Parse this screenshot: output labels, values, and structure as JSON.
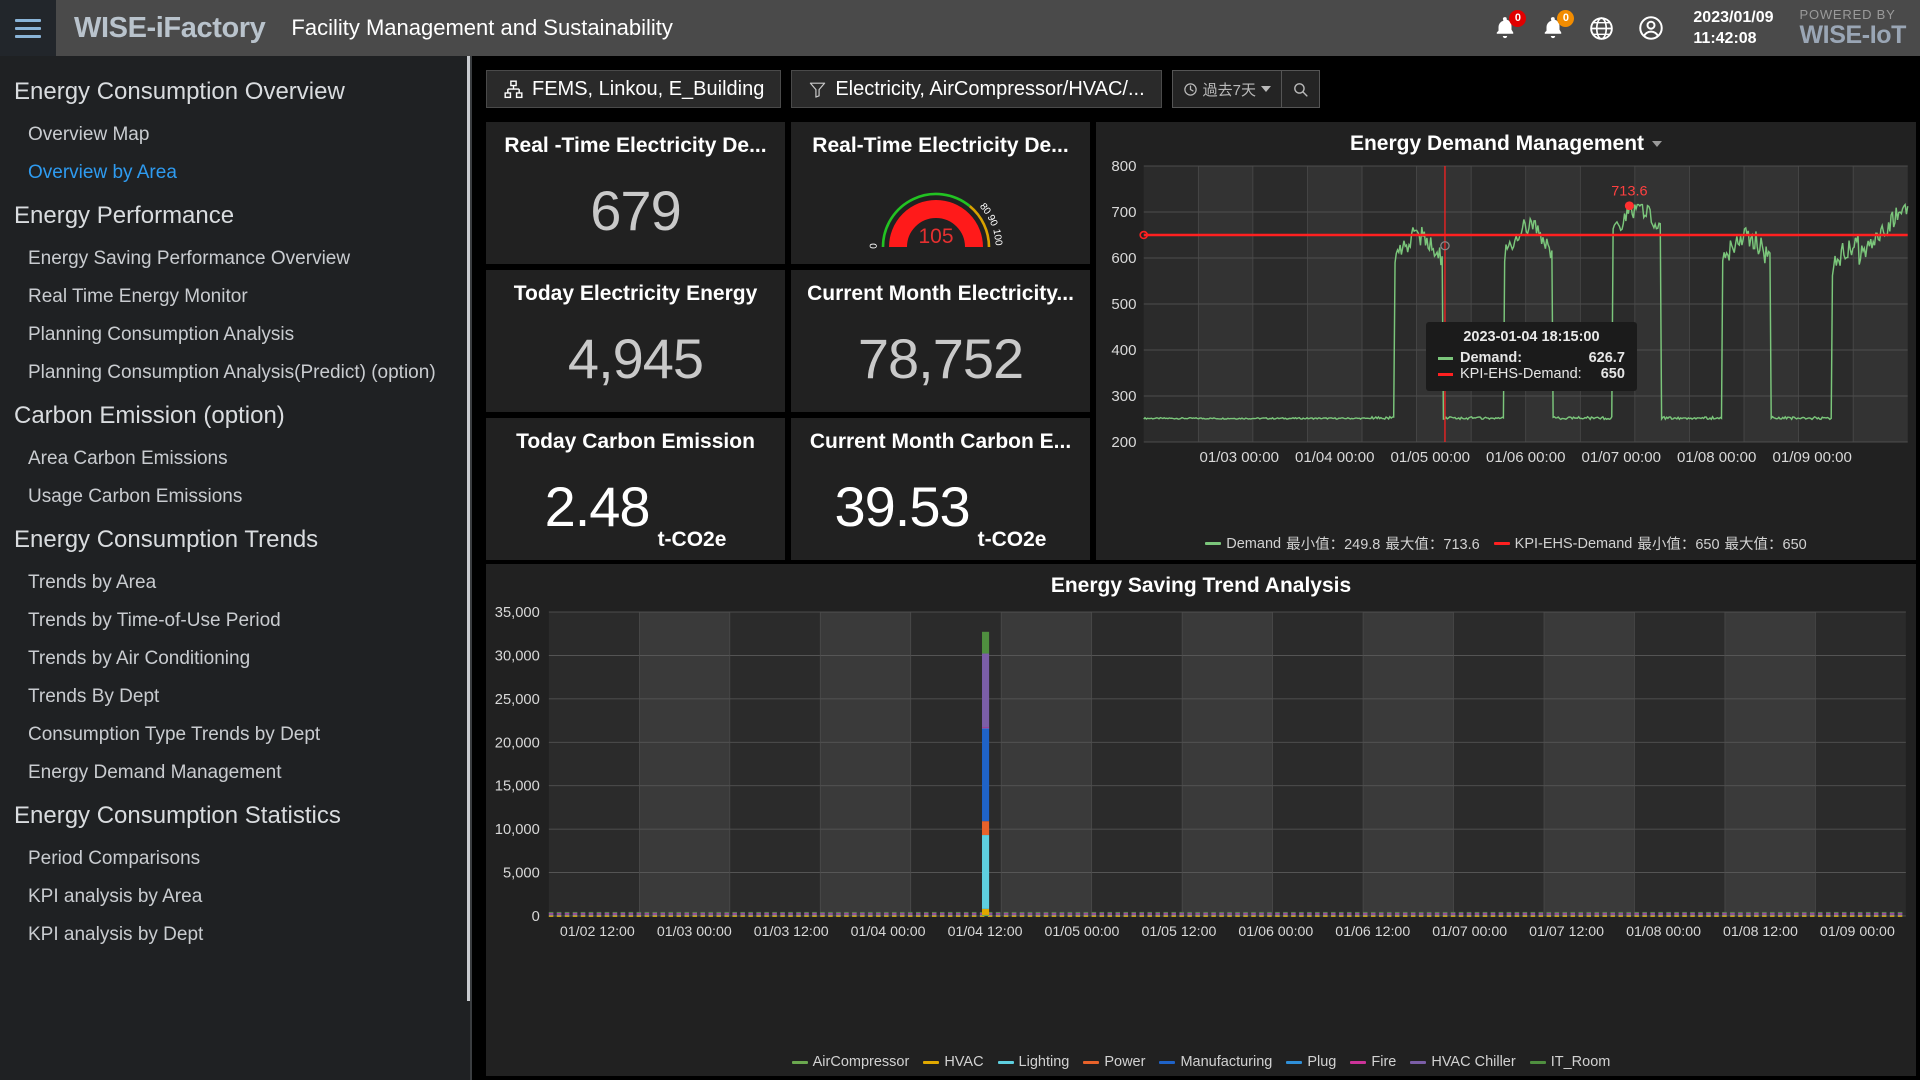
{
  "header": {
    "menu_icon": "hamburger-icon",
    "brand": "WISE-iFactory",
    "subtitle": "Facility Management and Sustainability",
    "alarm_badge": "0",
    "notify_badge": "0",
    "language_icon": "globe-icon",
    "account_icon": "user-circle-icon",
    "date": "2023/01/09",
    "time": "11:42:08",
    "powered_by": "POWERED BY",
    "powered_brand": "WISE-IoT"
  },
  "sidebar": {
    "sections": [
      {
        "title": "Energy Consumption Overview",
        "items": [
          {
            "label": "Overview Map",
            "active": false
          },
          {
            "label": "Overview by Area",
            "active": true
          }
        ]
      },
      {
        "title": "Energy Performance",
        "items": [
          {
            "label": "Energy Saving Performance Overview",
            "active": false
          },
          {
            "label": "Real Time Energy Monitor",
            "active": false
          },
          {
            "label": "Planning Consumption Analysis",
            "active": false
          },
          {
            "label": "Planning Consumption Analysis(Predict) (option)",
            "active": false
          }
        ]
      },
      {
        "title": "Carbon Emission (option)",
        "items": [
          {
            "label": "Area Carbon Emissions",
            "active": false
          },
          {
            "label": "Usage Carbon Emissions",
            "active": false
          }
        ]
      },
      {
        "title": "Energy Consumption Trends",
        "items": [
          {
            "label": "Trends by Area",
            "active": false
          },
          {
            "label": "Trends by Time-of-Use Period",
            "active": false
          },
          {
            "label": "Trends by Air Conditioning",
            "active": false
          },
          {
            "label": "Trends By Dept",
            "active": false
          },
          {
            "label": "Consumption Type Trends by Dept",
            "active": false
          },
          {
            "label": "Energy Demand Management",
            "active": false
          }
        ]
      },
      {
        "title": "Energy Consumption Statistics",
        "items": [
          {
            "label": "Period Comparisons",
            "active": false
          },
          {
            "label": "KPI analysis by Area",
            "active": false
          },
          {
            "label": "KPI analysis by Dept",
            "active": false
          }
        ]
      }
    ]
  },
  "filters": {
    "location_chip": "FEMS, Linkou, E_Building",
    "location_icon": "sitemap-icon",
    "category_chip": "Electricity, AirCompressor/HVAC/...",
    "category_icon": "funnel-icon",
    "date_range": "過去7天",
    "clock_icon": "clock-icon",
    "search_icon": "magnifier-icon"
  },
  "kpis": [
    {
      "title": "Real -Time Electricity De...",
      "value": "679",
      "unit": "",
      "type": "number"
    },
    {
      "title": "Real-Time Electricity De...",
      "value": "105",
      "unit": "",
      "type": "gauge",
      "gauge_ticks": [
        "0",
        "80",
        "90",
        "100"
      ],
      "gauge_min": 0,
      "gauge_max": 100
    },
    {
      "title": "Today Electricity Energy",
      "value": "4,945",
      "unit": "",
      "type": "number"
    },
    {
      "title": "Current Month Electricity...",
      "value": "78,752",
      "unit": "",
      "type": "number"
    },
    {
      "title": "Today Carbon Emission",
      "value": "2.48",
      "unit": "t-CO2e",
      "type": "number"
    },
    {
      "title": "Current Month Carbon E...",
      "value": "39.53",
      "unit": "t-CO2e",
      "type": "number"
    }
  ],
  "chart_data": [
    {
      "id": "energy-demand-management",
      "type": "line",
      "title": "Energy Demand Management",
      "xlabel": "",
      "ylabel": "",
      "ylim": [
        200,
        800
      ],
      "yticks": [
        200,
        300,
        400,
        500,
        600,
        700,
        800
      ],
      "xticks": [
        "01/03 00:00",
        "01/04 00:00",
        "01/05 00:00",
        "01/06 00:00",
        "01/07 00:00",
        "01/08 00:00",
        "01/09 00:00"
      ],
      "grid": true,
      "legend_position": "bottom",
      "annotation": {
        "label": "713.6",
        "value": 713.6
      },
      "series": [
        {
          "name": "Demand",
          "color": "#7bc67b",
          "min_label": "最小值：249.8",
          "max_label": "最大值：713.6",
          "min": 249.8,
          "max": 713.6
        },
        {
          "name": "KPI-EHS-Demand",
          "color": "#ff2020",
          "min_label": "最小值：650",
          "max_label": "最大值：650",
          "min": 650,
          "max": 650,
          "constant": 650
        }
      ],
      "tooltip": {
        "time": "2023-01-04 18:15:00",
        "rows": [
          {
            "name": "Demand:",
            "value": "626.7",
            "color": "#7bc67b"
          },
          {
            "name": "KPI-EHS-Demand:",
            "value": "650",
            "color": "#ff2020"
          }
        ]
      }
    },
    {
      "id": "energy-saving-trend-analysis",
      "type": "bar",
      "title": "Energy Saving Trend Analysis",
      "xlabel": "",
      "ylabel": "",
      "ylim": [
        0,
        35000
      ],
      "yticks": [
        "0",
        "5,000",
        "10,000",
        "15,000",
        "20,000",
        "25,000",
        "30,000",
        "35,000"
      ],
      "xticks": [
        "01/02 12:00",
        "01/03 00:00",
        "01/03 12:00",
        "01/04 00:00",
        "01/04 12:00",
        "01/05 00:00",
        "01/05 12:00",
        "01/06 00:00",
        "01/06 12:00",
        "01/07 00:00",
        "01/07 12:00",
        "01/08 00:00",
        "01/08 12:00",
        "01/09 00:00"
      ],
      "grid": true,
      "legend_position": "bottom",
      "stacked": true,
      "series": [
        {
          "name": "AirCompressor",
          "color": "#6ba84f",
          "peak": 120
        },
        {
          "name": "HVAC",
          "color": "#e0a800",
          "peak": 700
        },
        {
          "name": "Lighting",
          "color": "#5ecfdf",
          "peak": 8500
        },
        {
          "name": "Power",
          "color": "#e8622a",
          "peak": 1600
        },
        {
          "name": "Manufacturing",
          "color": "#1f63c8",
          "peak": 10700
        },
        {
          "name": "Plug",
          "color": "#2f8fd8",
          "peak": 60
        },
        {
          "name": "Fire",
          "color": "#cc3399",
          "peak": 40
        },
        {
          "name": "HVAC Chiller",
          "color": "#7b5ea7",
          "peak": 8500
        },
        {
          "name": "IT_Room",
          "color": "#4f8f3f",
          "peak": 2500
        }
      ],
      "peak_bar": {
        "x_label": "01/04 12:00",
        "total": 32500
      }
    }
  ]
}
